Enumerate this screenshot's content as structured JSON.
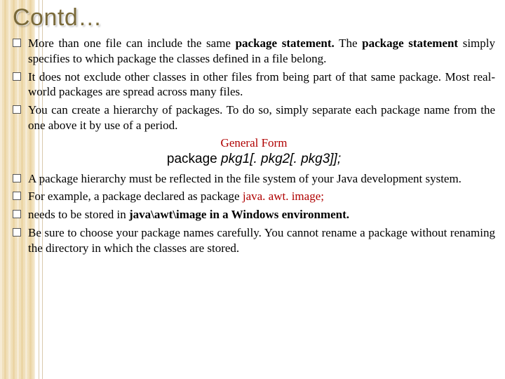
{
  "title": "Contd…",
  "bullets_top": [
    {
      "html": "More than one file can include the same <b>package statement.</b> The <b>package statement</b> simply specifies to which package the classes defined in a file belong."
    },
    {
      "html": "It does not exclude other classes in other files from being part of that same package. Most real-world packages are spread across many files."
    },
    {
      "html": "You can create a hierarchy of packages. To do so, simply separate each package name from the one above it by use of a period."
    }
  ],
  "general_form_label": "General Form",
  "package_line": {
    "keyword": "package",
    "args": "pkg1[. pkg2[. pkg3]];"
  },
  "bullets_bottom": [
    {
      "html": "A package hierarchy must be reflected in the file system of your Java development system."
    },
    {
      "html": "For example, a package declared as package <span class=\"red\">java. awt. image;</span>"
    },
    {
      "html": "needs to be stored in <b>java\\awt\\image in a Windows environment.</b>"
    },
    {
      "html": "Be sure to choose your package names carefully. You cannot rename a package without renaming the directory in which the classes are stored."
    }
  ]
}
